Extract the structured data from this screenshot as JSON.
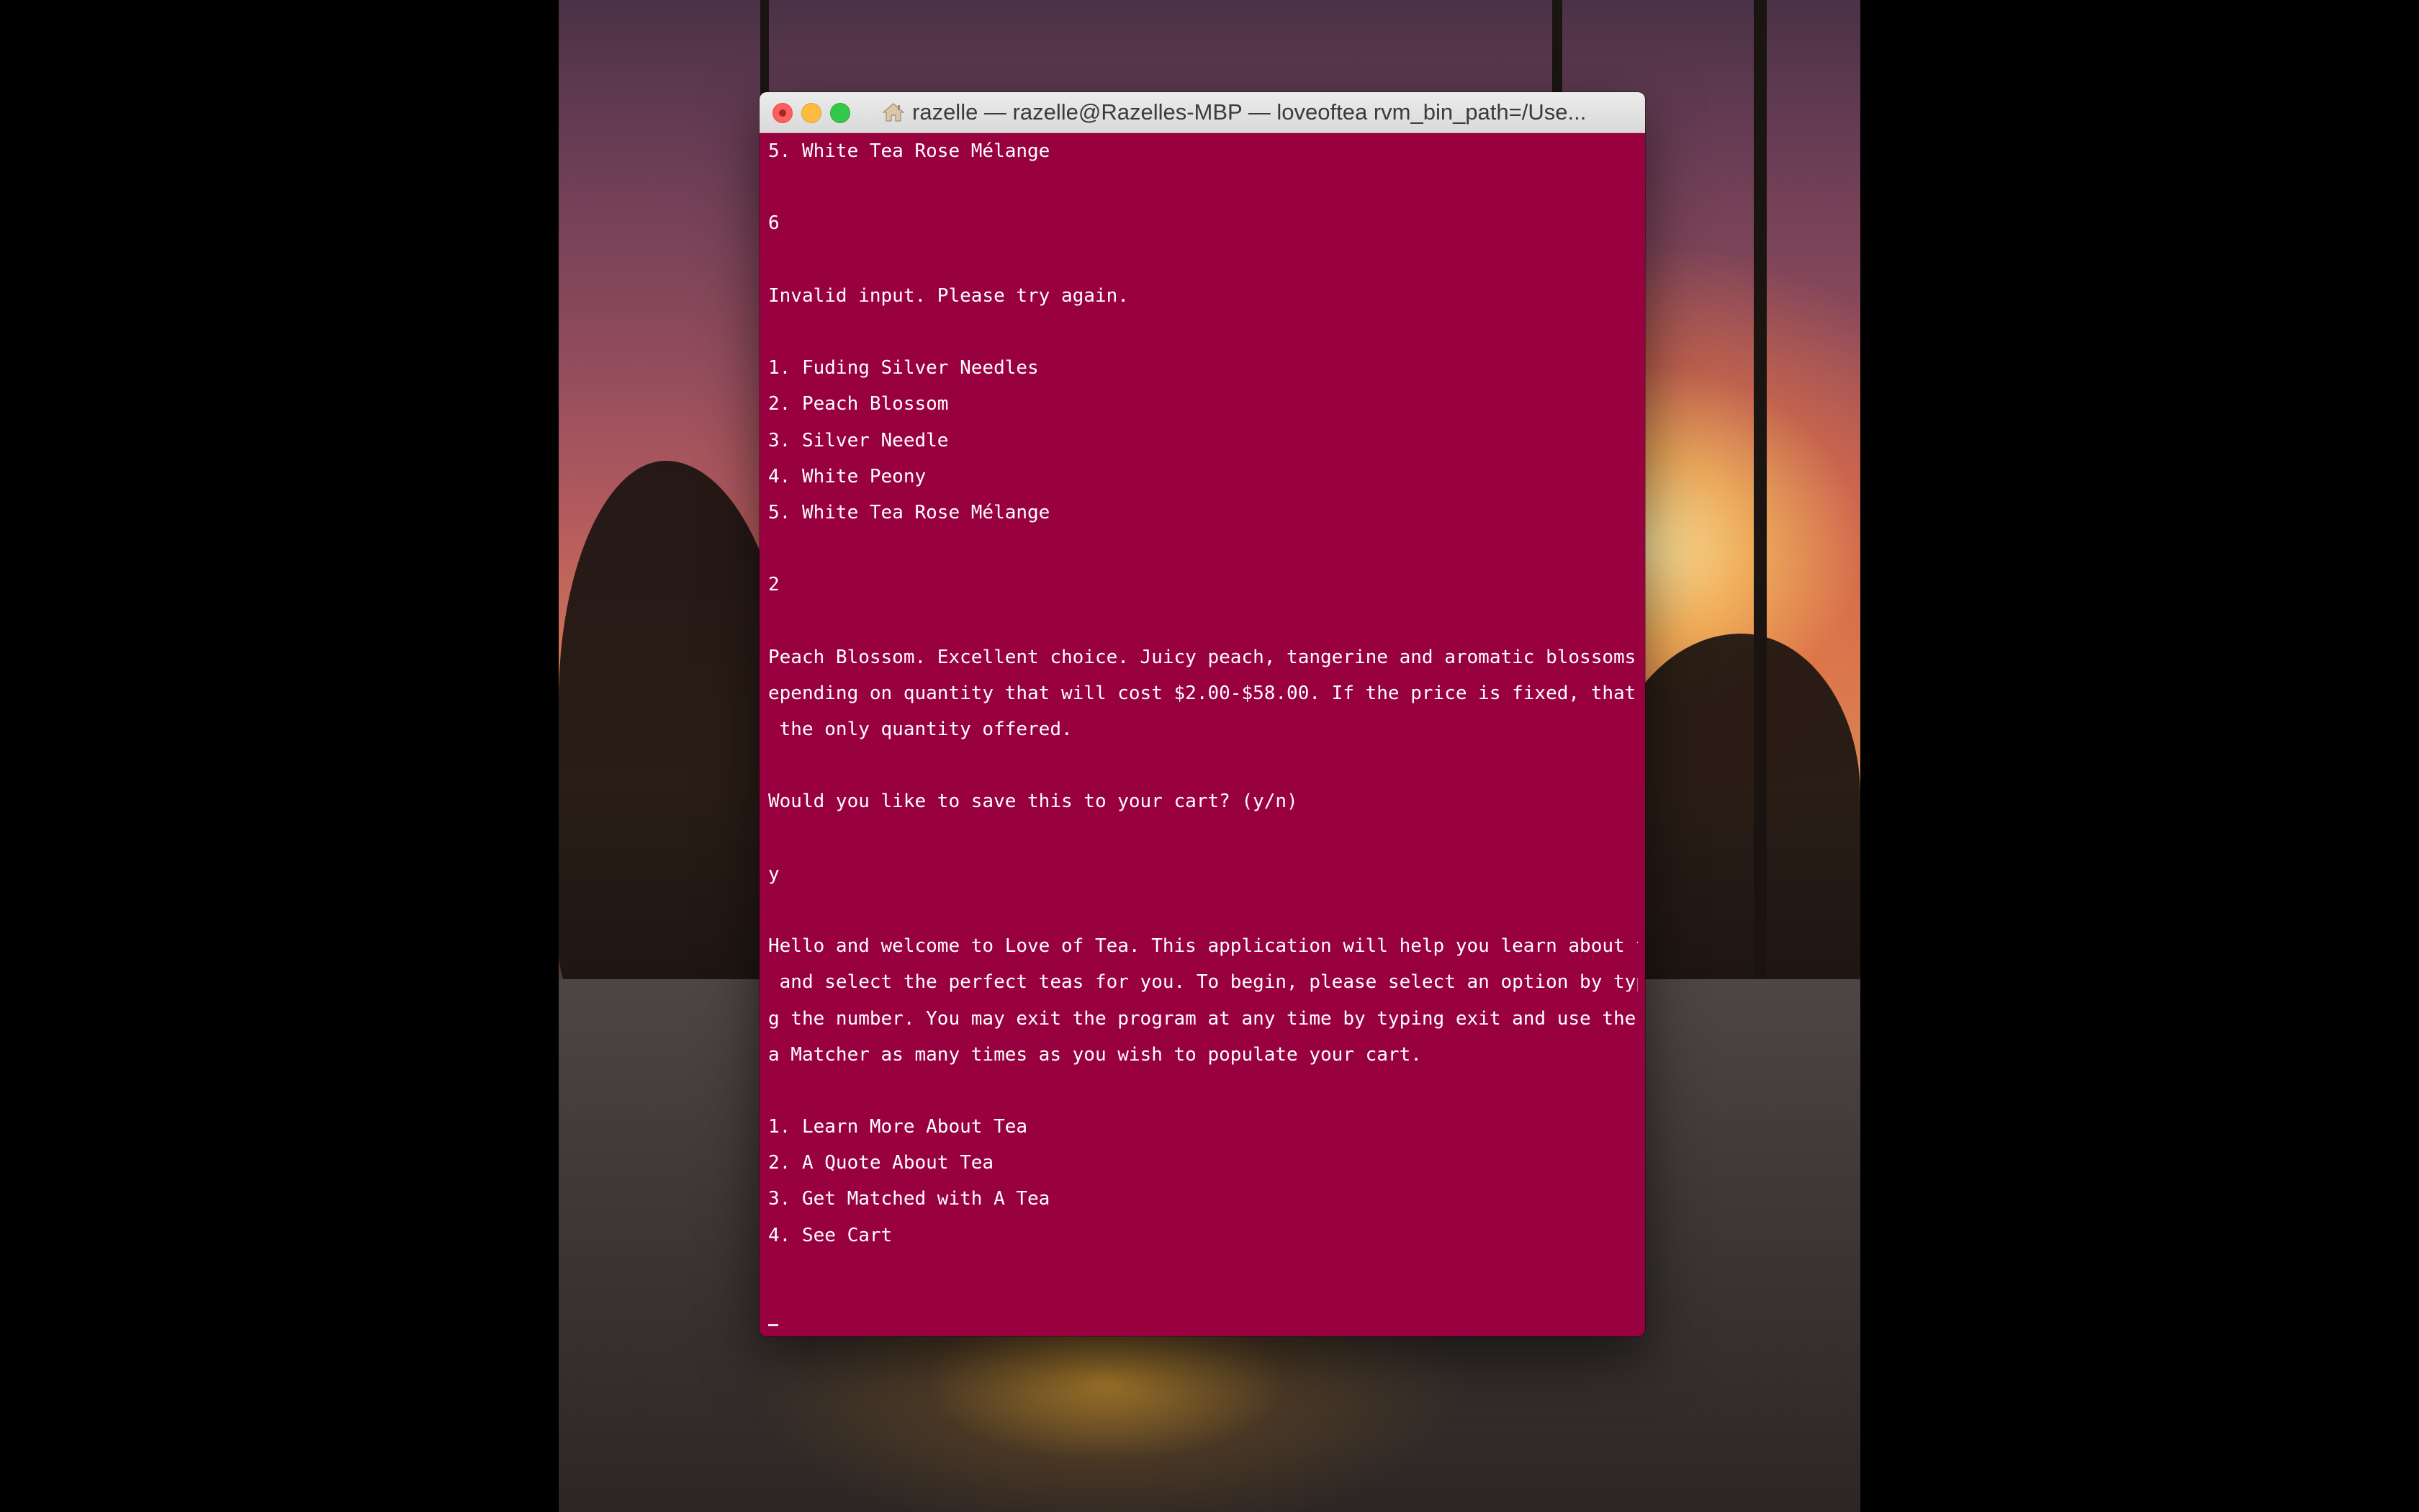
{
  "window": {
    "title": "razelle — razelle@Razelles-MBP — loveoftea rvm_bin_path=/Use..."
  },
  "terminal": {
    "background_color": "#990040",
    "text_color": "#ffffff",
    "lines": [
      "5. White Tea Rose Mélange",
      "",
      "6",
      "",
      "Invalid input. Please try again.",
      "",
      "1. Fuding Silver Needles",
      "2. Peach Blossom",
      "3. Silver Needle",
      "4. White Peony",
      "5. White Tea Rose Mélange",
      "",
      "2",
      "",
      "Peach Blossom. Excellent choice. Juicy peach, tangerine and aromatic blossoms. D",
      "epending on quantity that will cost $2.00-$58.00. If the price is fixed, that is",
      " the only quantity offered.",
      "",
      "Would you like to save this to your cart? (y/n)",
      "",
      "y",
      "",
      "Hello and welcome to Love of Tea. This application will help you learn about tea",
      " and select the perfect teas for you. To begin, please select an option by typin",
      "g the number. You may exit the program at any time by typing exit and use the Te",
      "a Matcher as many times as you wish to populate your cart.",
      "",
      "1. Learn More About Tea",
      "2. A Quote About Tea",
      "3. Get Matched with A Tea",
      "4. See Cart"
    ]
  },
  "icons": {
    "close": "close-window-icon",
    "minimize": "minimize-window-icon",
    "maximize": "maximize-window-icon",
    "home": "home-icon"
  }
}
